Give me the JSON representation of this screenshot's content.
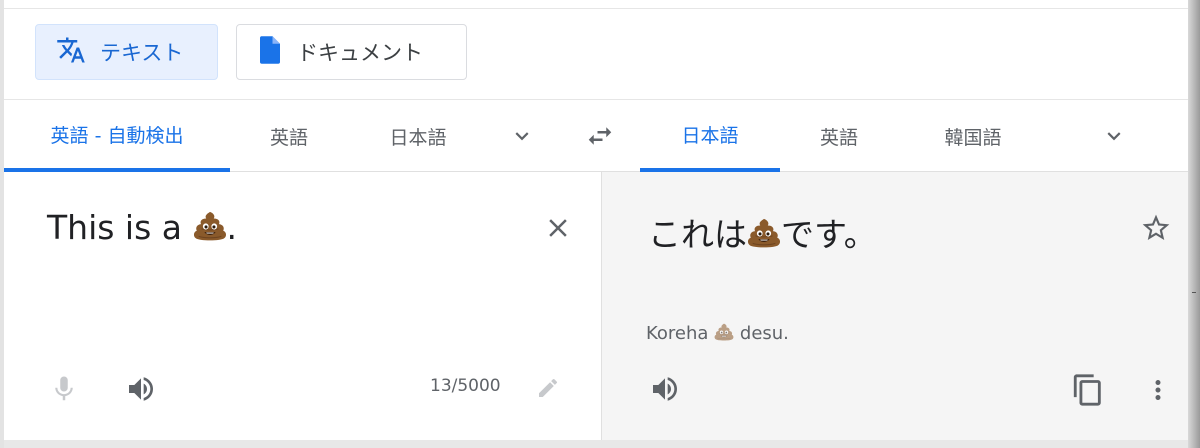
{
  "modes": {
    "text_label": "テキスト",
    "document_label": "ドキュメント"
  },
  "source_languages": {
    "tabs": [
      "英語 - 自動検出",
      "英語",
      "日本語"
    ],
    "active_index": 0
  },
  "target_languages": {
    "tabs": [
      "日本語",
      "英語",
      "韓国語"
    ],
    "active_index": 0
  },
  "source": {
    "text_before": "This is a ",
    "text_after": ".",
    "char_count": "13/5000"
  },
  "target": {
    "text_before": "これは",
    "text_after": "です。",
    "romanization_before": "Koreha ",
    "romanization_after": " desu."
  },
  "icons": {
    "translate": "translate-icon",
    "document": "document-icon",
    "more_languages": "chevron-down-icon",
    "swap": "swap-arrows-icon",
    "clear": "close-icon",
    "star": "star-outline-icon",
    "mic": "microphone-icon",
    "listen": "speaker-icon",
    "edit": "pencil-icon",
    "copy": "copy-icon",
    "more": "more-vert-icon"
  },
  "colors": {
    "accent": "#1a73e8",
    "active_bg": "#e8f0fe",
    "target_pane_bg": "#f5f5f5",
    "text_primary": "#202124",
    "text_secondary": "#5f6368"
  }
}
